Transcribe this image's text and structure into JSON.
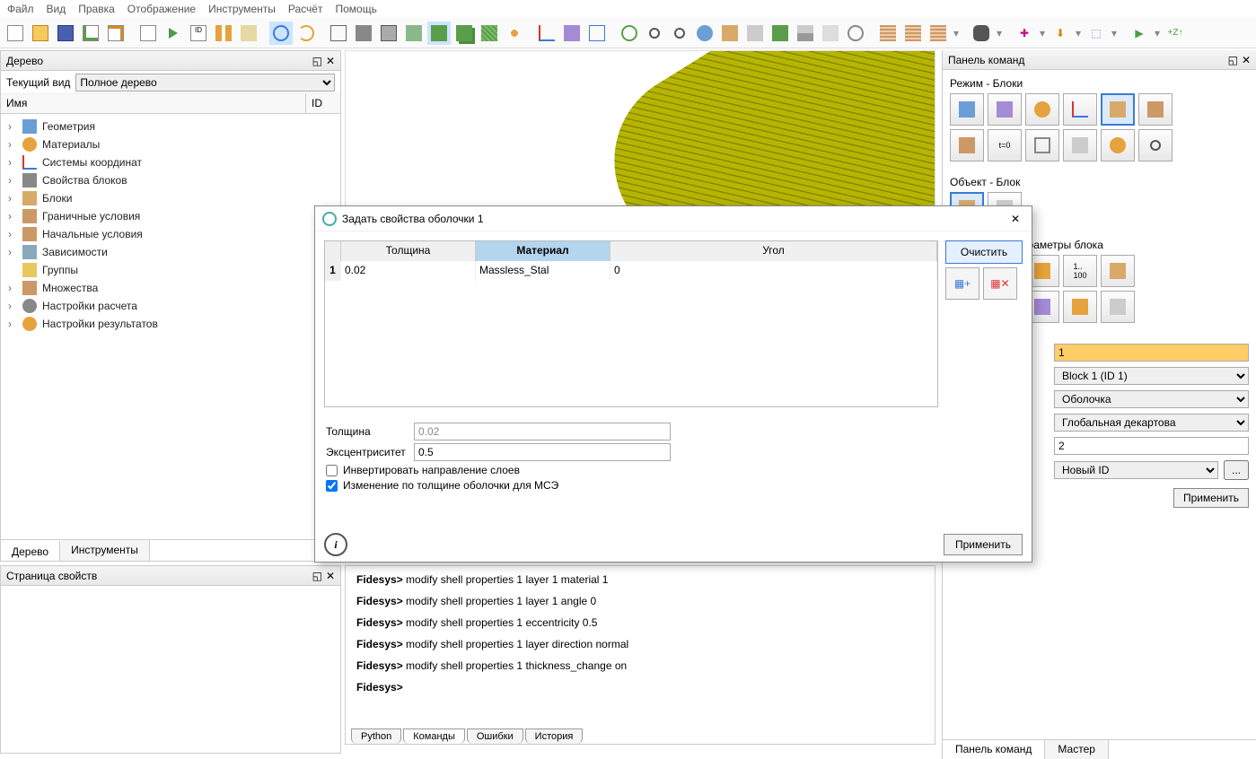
{
  "menu": [
    "Файл",
    "Вид",
    "Правка",
    "Отображение",
    "Инструменты",
    "Расчёт",
    "Помощь"
  ],
  "tree_panel": {
    "title": "Дерево",
    "view_label": "Текущий вид",
    "view_value": "Полное дерево",
    "col_name": "Имя",
    "col_id": "ID",
    "nodes": [
      "Геометрия",
      "Материалы",
      "Системы координат",
      "Свойства блоков",
      "Блоки",
      "Граничные условия",
      "Начальные условия",
      "Зависимости",
      "Группы",
      "Множества",
      "Настройки расчета",
      "Настройки результатов"
    ],
    "tabs": [
      "Дерево",
      "Инструменты"
    ]
  },
  "prop_panel": {
    "title": "Страница свойств"
  },
  "console": {
    "lines": [
      "modify shell properties 1 layer 1 material 1",
      "modify shell properties 1 layer 1 angle 0",
      "modify shell properties 1 eccentricity 0.5",
      "modify shell properties 1 layer direction normal",
      "modify shell properties 1 thickness_change on",
      ""
    ],
    "prompt": "Fidesys>",
    "tabs": [
      "Python",
      "Команды",
      "Ошибки",
      "История"
    ],
    "active_tab": 1
  },
  "cmd_panel": {
    "title": "Панель команд",
    "sec1": "Режим - Блоки",
    "sec2": "Объект - Блок",
    "sec3": "е - Свойства/параметры блока",
    "input_id": "1",
    "select_block": "Block 1 (ID 1)",
    "select_type": "Оболочка",
    "select_cs": "Глобальная декартова",
    "order": "2",
    "id_option": "Новый ID",
    "ellipsis": "...",
    "apply": "Применить",
    "bottom_tabs": [
      "Панель команд",
      "Мастер"
    ]
  },
  "dialog": {
    "title": "Задать свойства оболочки 1",
    "headers": [
      "Толщина",
      "Материал",
      "Угол"
    ],
    "row": {
      "num": "1",
      "thickness": "0.02",
      "material": "Massless_Stal",
      "angle": "0"
    },
    "clear": "Очистить",
    "thickness_label": "Толщина",
    "thickness_val": "0.02",
    "ecc_label": "Эксцентриситет",
    "ecc_val": "0.5",
    "invert": "Инвертировать направление слоев",
    "thchange": "Изменение по толщине оболочки для МСЭ",
    "apply": "Применить"
  }
}
